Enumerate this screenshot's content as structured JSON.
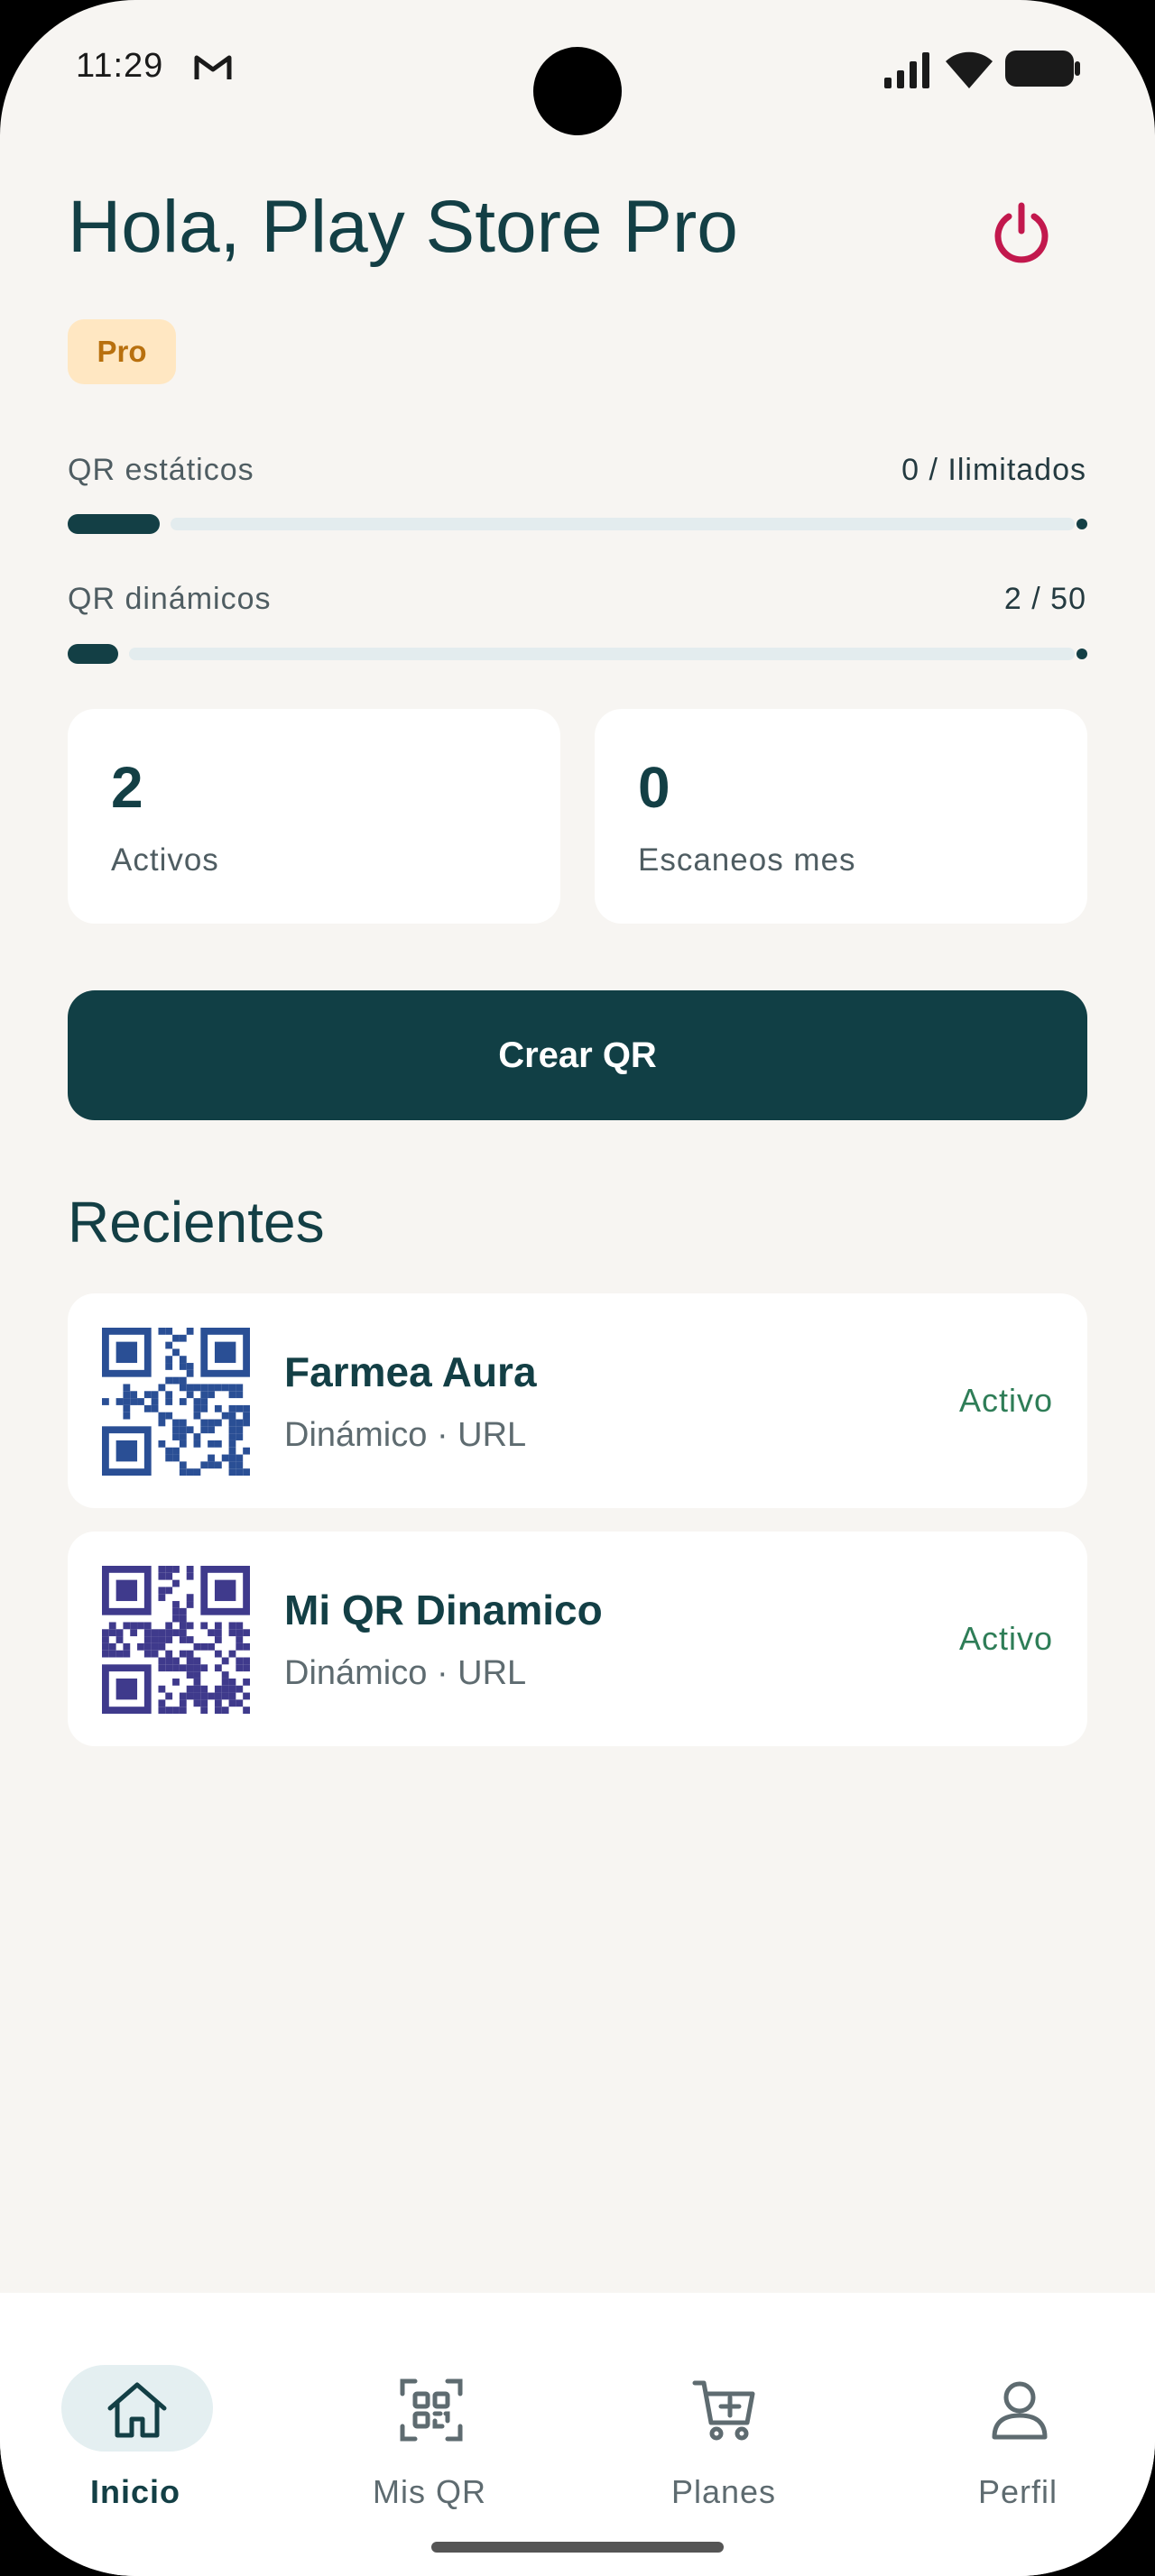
{
  "status_bar": {
    "time": "11:29"
  },
  "header": {
    "greeting": "Hola, Play Store Pro",
    "plan_badge": "Pro"
  },
  "usage": {
    "static": {
      "label": "QR estáticos",
      "value": "0 / Ilimitados"
    },
    "dynamic": {
      "label": "QR dinámicos",
      "value": "2 / 50",
      "used": 2,
      "limit": 50
    }
  },
  "stats": [
    {
      "value": "2",
      "label": "Activos"
    },
    {
      "value": "0",
      "label": "Escaneos mes"
    }
  ],
  "create_button": {
    "label": "Crear QR"
  },
  "recent": {
    "title": "Recientes",
    "items": [
      {
        "name": "Farmea Aura",
        "meta": "Dinámico · URL",
        "status": "Activo",
        "qr_color": "#2a4f95"
      },
      {
        "name": "Mi QR Dinamico",
        "meta": "Dinámico · URL",
        "status": "Activo",
        "qr_color": "#3f3a8c"
      }
    ]
  },
  "nav": [
    {
      "label": "Inicio",
      "icon": "home-icon",
      "active": true
    },
    {
      "label": "Mis QR",
      "icon": "qr-grid-icon",
      "active": false
    },
    {
      "label": "Planes",
      "icon": "cart-plus-icon",
      "active": false
    },
    {
      "label": "Perfil",
      "icon": "person-icon",
      "active": false
    }
  ],
  "colors": {
    "primary": "#133f45",
    "background": "#f7f5f2",
    "power": "#c2184d",
    "active_status": "#2e7d57",
    "badge_bg": "#ffe7c2",
    "badge_text": "#b8700e"
  }
}
